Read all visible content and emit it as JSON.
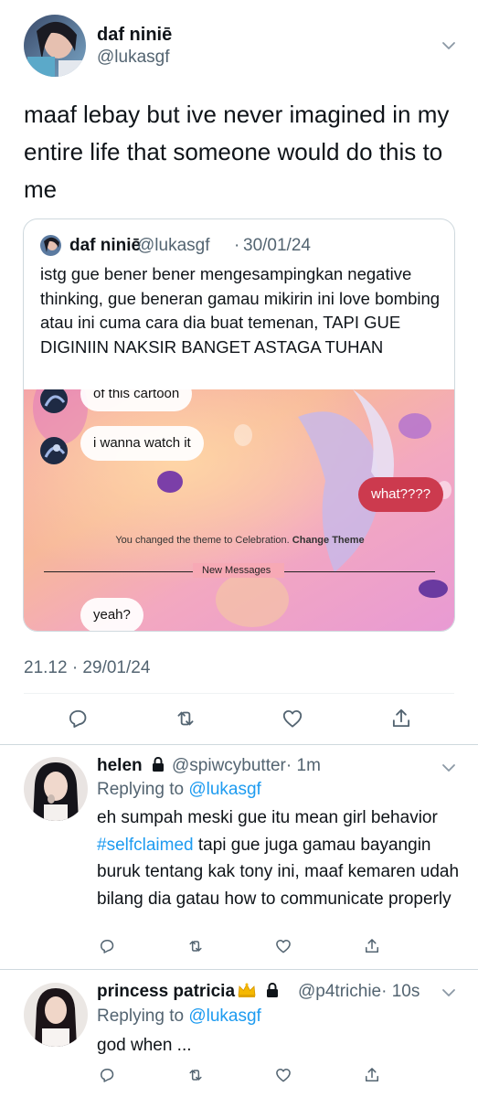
{
  "main_tweet": {
    "display_name": "daf niniē",
    "handle": "@lukasgf",
    "text": "maaf lebay but ive never imagined in my entire life that someone would do this to me",
    "timestamp": "21.12 · 29/01/24",
    "avatar_icon": "avatar-photo"
  },
  "quoted_tweet": {
    "display_name": "daf niniē",
    "handle": "@lukasgf",
    "separator": "·",
    "date": "30/01/24",
    "text": "istg gue bener bener mengesampingkan negative thinking, gue beneran gamau mikirin ini love bombing atau ini cuma cara dia buat temenan, TAPI GUE DIGINIIN NAKSIR BANGET ASTAGA TUHAN",
    "media": {
      "bubble_cartoon": "of this cartoon",
      "bubble_watch": "i wanna watch it",
      "bubble_what": "what????",
      "theme_notice": "You changed the theme to Celebration.",
      "theme_action": "Change Theme",
      "new_messages": "New Messages",
      "bubble_yeah": "yeah?",
      "accent_color": "#cc3a4e"
    }
  },
  "actions": {
    "reply_icon": "reply-icon",
    "retweet_icon": "retweet-icon",
    "like_icon": "heart-icon",
    "share_icon": "share-icon"
  },
  "replies": [
    {
      "display_name": "helen",
      "lock_icon": "lock-icon",
      "handle": "@spiwcybutter",
      "time": "· 1m",
      "replying_prefix": "Replying to",
      "replying_to": "@lukasgf",
      "text_before": "eh sumpah meski gue itu mean girl behavior ",
      "hashtag": "#selfclaimed",
      "text_after": " tapi gue juga gamau bayangin buruk tentang kak tony ini, maaf kemaren udah bilang dia gatau how to communicate properly"
    },
    {
      "display_name": "princess patricia",
      "crown_icon": "crown-emoji",
      "lock_icon": "lock-icon",
      "handle": "@p4trichie",
      "time": "· 10s",
      "replying_prefix": "Replying to",
      "replying_to": "@lukasgf",
      "text": "god when ..."
    }
  ],
  "colors": {
    "link": "#1d9bf0",
    "secondary_text": "#536471",
    "primary_text": "#0f1419"
  }
}
